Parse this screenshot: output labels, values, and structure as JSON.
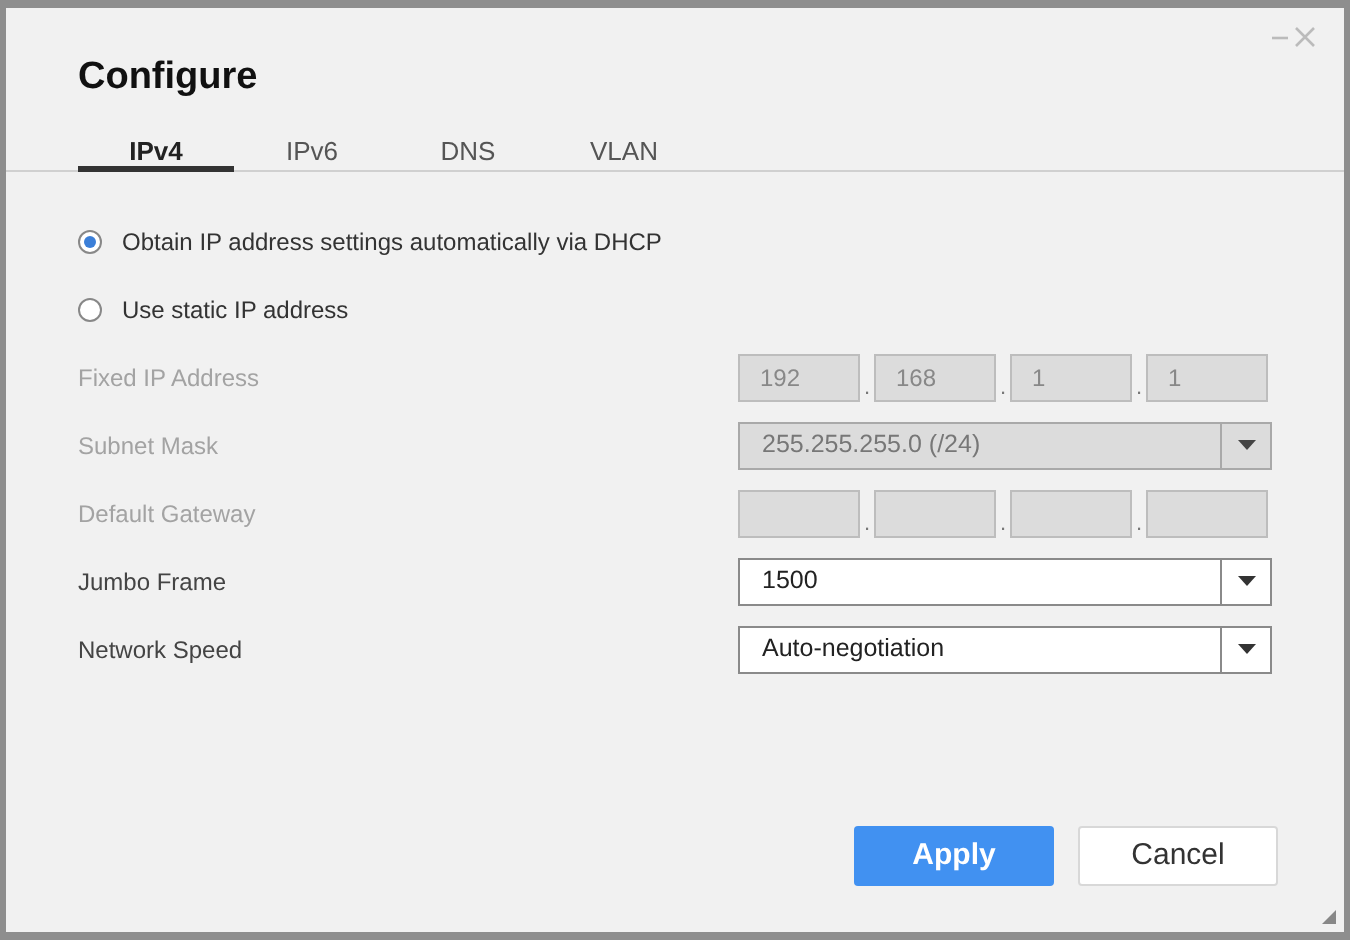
{
  "window": {
    "title": "Configure"
  },
  "tabs": [
    {
      "label": "IPv4",
      "selected": true
    },
    {
      "label": "IPv6",
      "selected": false
    },
    {
      "label": "DNS",
      "selected": false
    },
    {
      "label": "VLAN",
      "selected": false
    }
  ],
  "options": [
    {
      "label": "Obtain IP address settings automatically via DHCP",
      "selected": true
    },
    {
      "label": "Use static IP address",
      "selected": false
    }
  ],
  "fields": [
    {
      "kind": "ip",
      "label": "Fixed IP Address",
      "disabled": true,
      "octets": [
        "192",
        "168",
        "1",
        "1"
      ],
      "separator": "."
    },
    {
      "kind": "select",
      "label": "Subnet Mask",
      "disabled": true,
      "value": "255.255.255.0 (/24)"
    },
    {
      "kind": "ip",
      "label": "Default Gateway",
      "disabled": true,
      "separator": "."
    },
    {
      "kind": "select",
      "label": "Jumbo Frame",
      "disabled": false,
      "value": "1500"
    },
    {
      "kind": "select",
      "label": "Network Speed",
      "disabled": false,
      "value": "Auto-negotiation"
    }
  ],
  "buttons": [
    {
      "label": "Apply",
      "kind": "primary"
    },
    {
      "label": "Cancel",
      "kind": "secondary"
    }
  ]
}
